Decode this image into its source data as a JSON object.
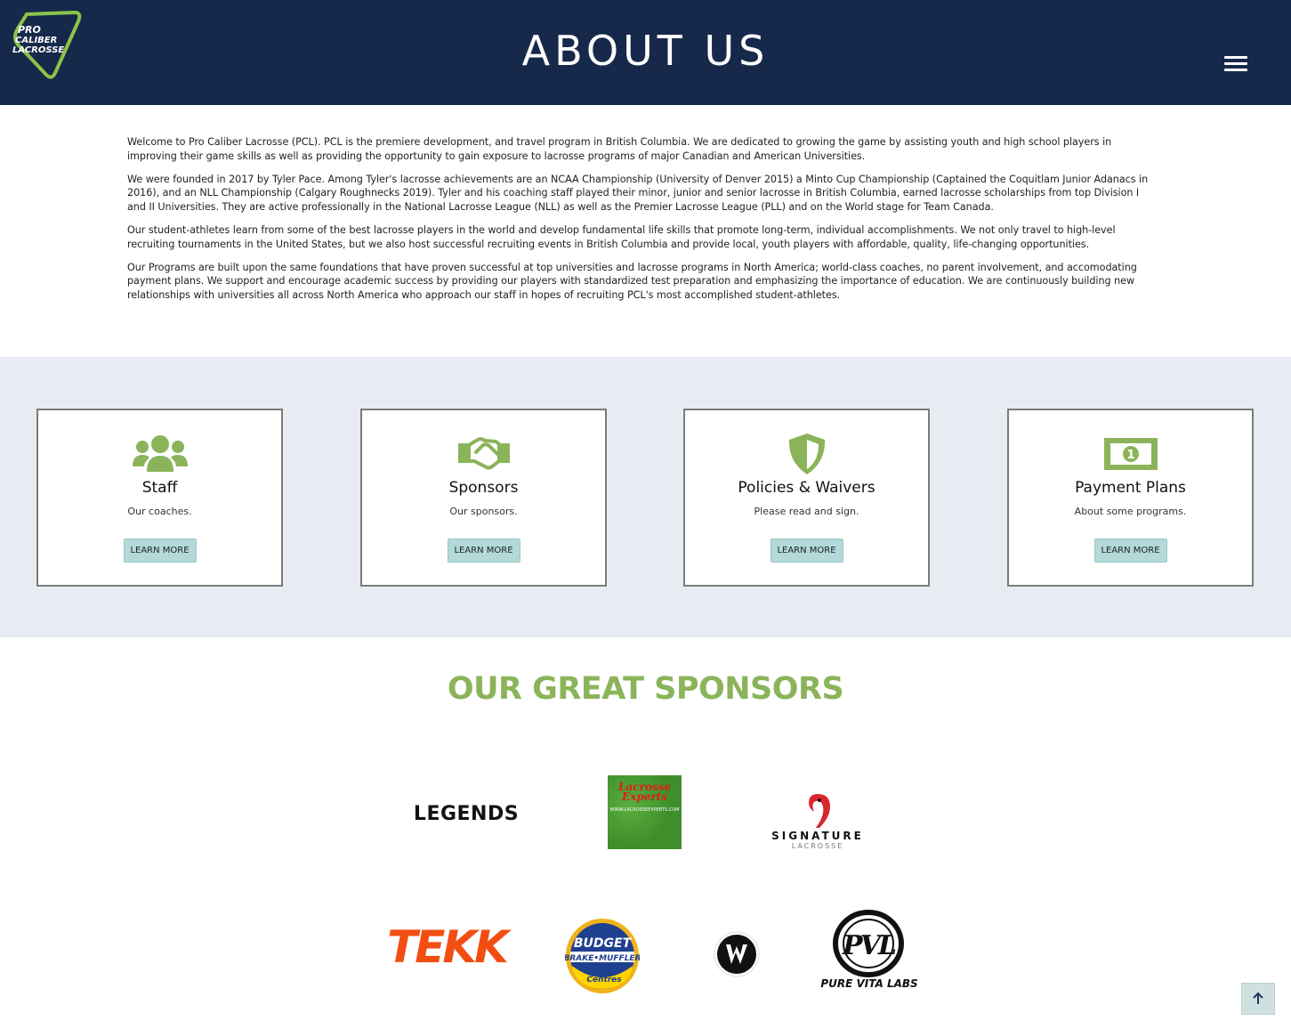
{
  "header": {
    "logo_text": [
      "PRO",
      "CALIBER",
      "LACROSSE"
    ],
    "title": "ABOUT US",
    "menu_icon": "hamburger-menu-icon"
  },
  "intro": {
    "paragraphs": [
      "Welcome to Pro Caliber Lacrosse (PCL). PCL is the premiere development, and travel program in British Columbia. We are dedicated to growing the game by assisting youth and high school players in improving their game skills as well as providing the opportunity to gain exposure to lacrosse programs of major Canadian and American Universities.",
      "We were founded in 2017 by Tyler Pace. Among Tyler's lacrosse achievements are an NCAA Championship (University of Denver 2015) a Minto Cup Championship (Captained the Coquitlam Junior Adanacs in 2016), and an NLL Championship (Calgary Roughnecks 2019). Tyler and his coaching staff played their minor, junior and senior lacrosse in British Columbia, earned lacrosse scholarships from top Division I and II Universities. They are active professionally in the National Lacrosse League (NLL) as well as the Premier Lacrosse League (PLL) and on the World stage for Team Canada.",
      "Our student-athletes learn from some of the best lacrosse players in the world and develop fundamental life skills that promote long-term, individual accomplishments. We not only travel to high-level recruiting tournaments in the United States, but we also host successful recruiting events in British Columbia and provide local, youth players with affordable, quality, life-changing opportunities.",
      "Our Programs are built upon the same foundations that have proven successful at top universities and lacrosse programs in North America; world-class coaches, no parent involvement, and accomodating payment plans. We support and encourage academic success by providing our players with standardized test preparation and emphasizing the importance of education. We are continuously building new relationships with universities all across North America who approach our staff in hopes of recruiting PCL's most accomplished student-athletes."
    ]
  },
  "cards": [
    {
      "icon": "users-icon",
      "title": "Staff",
      "desc": "Our coaches.",
      "button": "LEARN MORE"
    },
    {
      "icon": "handshake-icon",
      "title": "Sponsors",
      "desc": "Our sponsors.",
      "button": "LEARN MORE"
    },
    {
      "icon": "shield-icon",
      "title": "Policies & Waivers",
      "desc": "Please read and sign.",
      "button": "LEARN MORE"
    },
    {
      "icon": "money-bill-icon",
      "title": "Payment Plans",
      "desc": "About some programs.",
      "button": "LEARN MORE"
    }
  ],
  "sponsors": {
    "title": "OUR GREAT SPONSORS",
    "logos": {
      "legends": "LEGENDS",
      "lacrosse_experts": [
        "Lacrosse",
        "Experts"
      ],
      "lacrosse_experts_url": "WWW.LACROSSEEXPERTS.COM",
      "signature": "SIGNATURE",
      "signature_sub": "LACROSSE",
      "tekk": "TEKK",
      "budget": [
        "BUDGET",
        "BRAKE•MUFFLER",
        "Auto",
        "Centres"
      ],
      "warrior": "warrior-logo",
      "pvl_mark": "PVL",
      "pvl_caption": "PURE VITA LABS"
    }
  },
  "colors": {
    "header_bg": "#17294a",
    "accent_green": "#8bb45a",
    "band_bg": "#e8ecf2",
    "button_bg": "#b3d9d9"
  },
  "back_to_top_icon": "arrow-up-icon"
}
